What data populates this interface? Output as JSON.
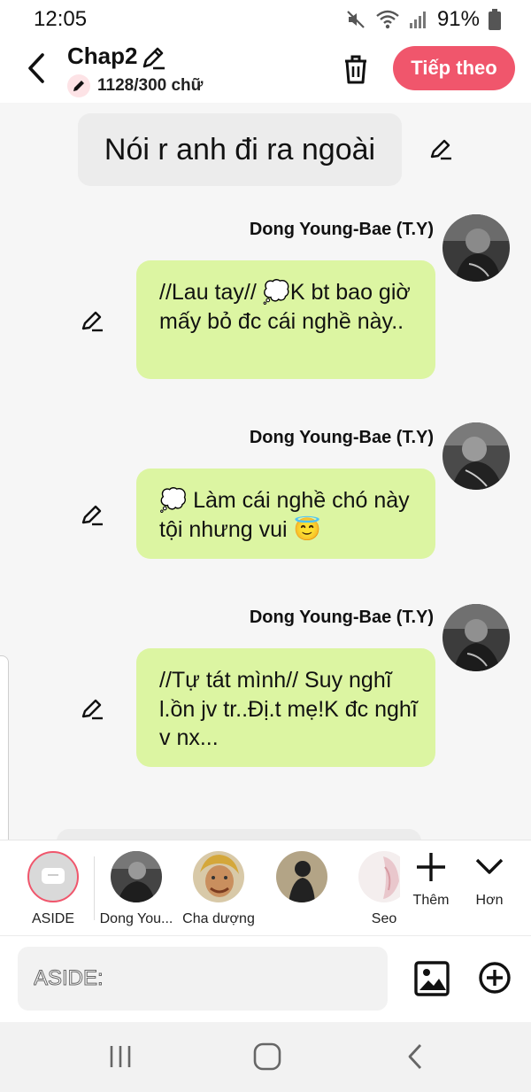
{
  "status_bar": {
    "time": "12:05",
    "battery": "91%",
    "icons": [
      "mute-icon",
      "wifi-icon",
      "signal-icon",
      "battery-icon"
    ]
  },
  "header": {
    "title": "Chap2",
    "word_count": "1128/300 chữ",
    "next_button": "Tiếp theo",
    "accent_color": "#f0566c"
  },
  "chat": {
    "narration": "Nói r anh đi ra ngoài",
    "messages": [
      {
        "speaker": "Dong Young-Bae (T.Y)",
        "text": "//Lau tay// 💭K bt bao giờ mấy bỏ đc cái nghề này.."
      },
      {
        "speaker": "Dong Young-Bae (T.Y)",
        "text": "💭 Làm cái nghề chó này tội nhưng vui 😇"
      },
      {
        "speaker": "Dong Young-Bae (T.Y)",
        "text": "//Tự tát mình// Suy nghĩ l.ồn jv tr..Đị.t mẹ!K đc nghĩ v nx..."
      }
    ],
    "bubble_color": "#dcf5a2"
  },
  "characters": [
    {
      "label": "ASIDE"
    },
    {
      "label": "Dong You..."
    },
    {
      "label": "Cha dượng"
    },
    {
      "label": ""
    },
    {
      "label": "Seo"
    }
  ],
  "tools": {
    "add_label": "Thêm",
    "more_label": "Hơn"
  },
  "input": {
    "placeholder": "ASIDE:"
  }
}
